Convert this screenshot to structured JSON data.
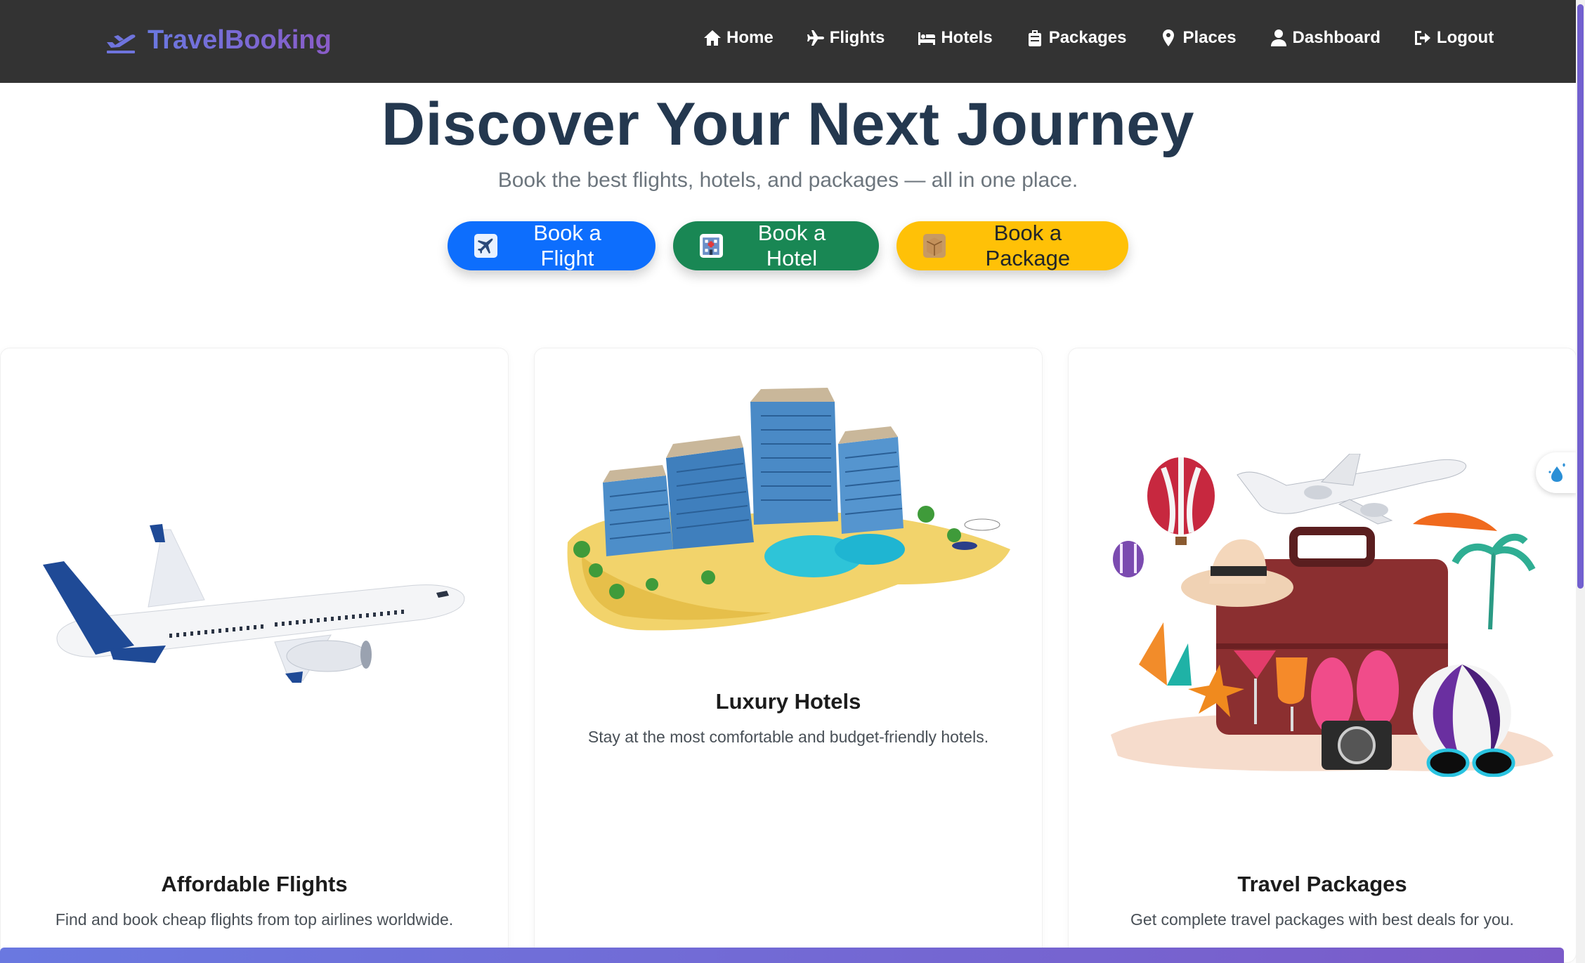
{
  "brand": {
    "name": "TravelBooking",
    "icon": "plane-departure-icon"
  },
  "nav": {
    "items": [
      {
        "label": "Home",
        "icon": "house-icon"
      },
      {
        "label": "Flights",
        "icon": "plane-icon"
      },
      {
        "label": "Hotels",
        "icon": "bed-icon"
      },
      {
        "label": "Packages",
        "icon": "suitcase-icon"
      },
      {
        "label": "Places",
        "icon": "map-pin-icon"
      },
      {
        "label": "Dashboard",
        "icon": "user-icon"
      },
      {
        "label": "Logout",
        "icon": "logout-icon"
      }
    ]
  },
  "hero": {
    "title": "Discover Your Next Journey",
    "subtitle": "Book the best flights, hotels, and packages — all in one place.",
    "buttons": {
      "flight": "Book a Flight",
      "hotel": "Book a Hotel",
      "package": "Book a Package"
    }
  },
  "cards": [
    {
      "title": "Affordable Flights",
      "text": "Find and book cheap flights from top airlines worldwide.",
      "image": "airplane-image"
    },
    {
      "title": "Luxury Hotels",
      "text": "Stay at the most comfortable and budget-friendly hotels.",
      "image": "resort-hotel-image"
    },
    {
      "title": "Travel Packages",
      "text": "Get complete travel packages with best deals for you.",
      "image": "travel-suitcase-image"
    }
  ],
  "colors": {
    "navbar": "#333333",
    "brand": "#7b6bd6",
    "title": "#24384f",
    "flight_btn": "#0d6efd",
    "hotel_btn": "#198754",
    "package_btn": "#ffc107"
  }
}
